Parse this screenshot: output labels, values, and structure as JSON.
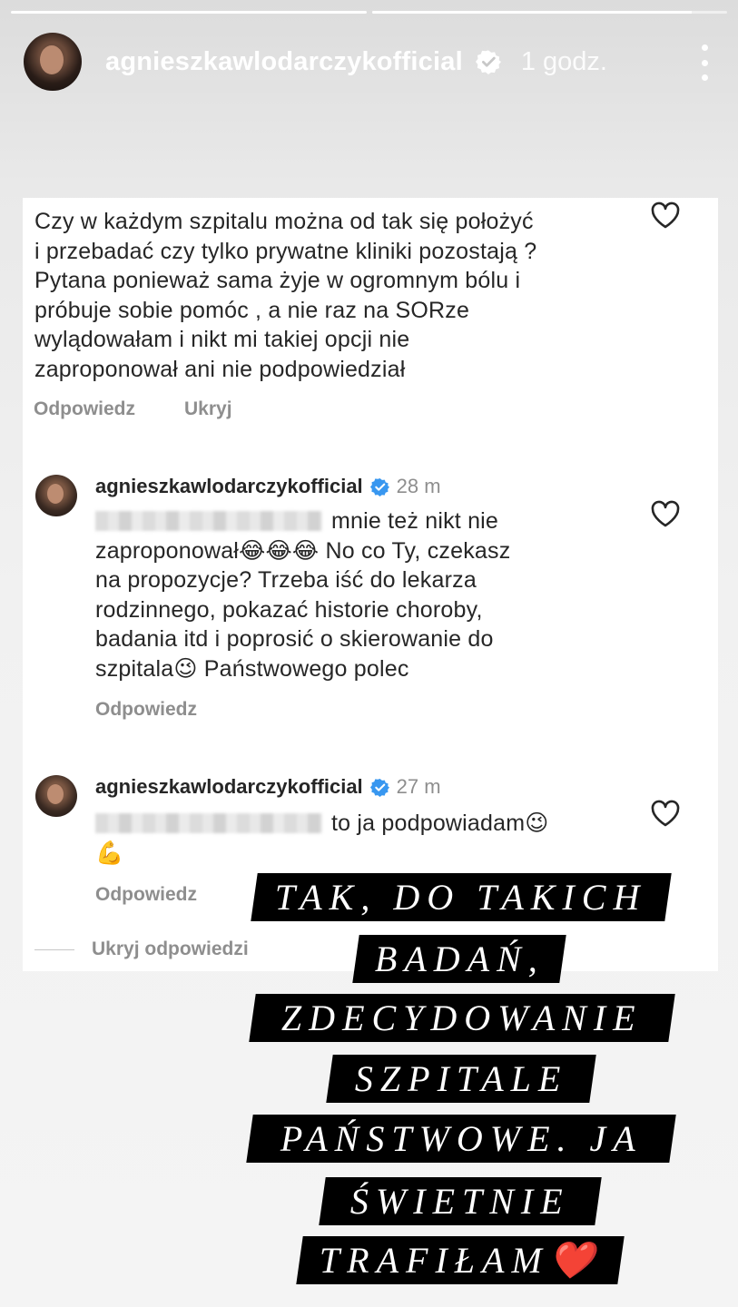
{
  "story": {
    "progress": [
      1.0,
      0.9
    ],
    "username": "agnieszkawlodarczykofficial",
    "time": "1 godz."
  },
  "comment": {
    "lines": [
      "Czy w każdym szpitalu można od tak się położyć",
      "i przebadać czy tylko prywatne kliniki pozostają ?",
      "Pytana ponieważ sama żyje w ogromnym bólu i",
      "próbuje sobie pomóc , a nie raz na SORze",
      "wylądowałam i nikt mi takiej opcji nie",
      "zaproponował ani nie podpowiedział"
    ],
    "reply_label": "Odpowiedz",
    "hide_label": "Ukryj"
  },
  "replies": [
    {
      "username": "agnieszkawlodarczykofficial",
      "time": "28 m",
      "line1": "mnie też nikt nie",
      "line2_a": "zaproponował",
      "line2_emoji": "😂😂😂",
      "line2_b": " No co Ty, czekasz",
      "lines_rest": [
        "na propozycje? Trzeba iść do lekarza",
        "rodzinnego, pokazać historie choroby,",
        "badania itd i poprosić o skierowanie do"
      ],
      "last_a": "szpitala",
      "last_emoji": "😉",
      "last_b": " Państwowego polec",
      "reply_label": "Odpowiedz"
    },
    {
      "username": "agnieszkawlodarczykofficial",
      "time": "27 m",
      "line1": "to ja podpowiadam",
      "line1_emoji": "😉",
      "line2_emoji": "💪",
      "reply_label": "Odpowiedz"
    }
  ],
  "hide_replies_label": "Ukryj odpowiedzi",
  "overlay_text": [
    "TAK, DO TAKICH",
    "BADAŃ,",
    "ZDECYDOWANIE",
    "SZPITALE",
    "PAŃSTWOWE. JA",
    "ŚWIETNIE",
    "TRAFIŁAM❤️"
  ],
  "colors": {
    "verified": "#3897f0",
    "secondary_text": "#8e8e8e",
    "overlay_bg": "#000000"
  }
}
